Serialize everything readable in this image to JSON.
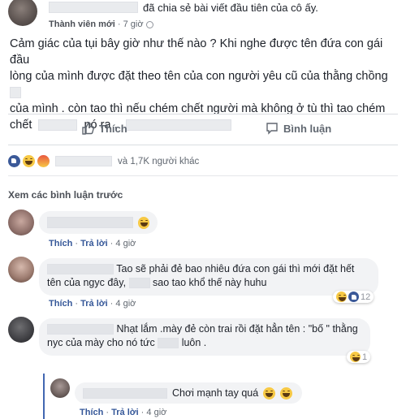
{
  "post": {
    "header_text": "đã chia sẻ bài viết đầu tiên của cô ấy.",
    "member_label": "Thành viên mới",
    "separator": "·",
    "time": "7 giờ",
    "body_line1": "Cảm giác của tụi bây giờ như thế nào ? Khi nghe được tên đứa con gái đầu",
    "body_line2": "lòng của mình được đặt theo tên của con người yêu cũ của thằng chồng",
    "body_line3": "của mình . còn tao thì nếu chém chết người mà không ở tù thì tao chém",
    "body_line4a": "chết",
    "body_line4b": "nó ra ."
  },
  "actions": {
    "like_label": "Thích",
    "comment_label": "Bình luận"
  },
  "reactions": {
    "summary": "và 1,7K người khác"
  },
  "comments_section": {
    "view_previous": "Xem các bình luận trước"
  },
  "comments": [
    {
      "text": "",
      "like": "Thích",
      "reply": "Trả lời",
      "time": "4 giờ"
    },
    {
      "text_line1": "Tao sẽ phải đẻ bao nhiêu đứa con gái thì mới đặt hết",
      "text_line2a": "tên của ngyc đây,",
      "text_line2b": "sao tao khổ thế này huhu",
      "reaction_count": "12",
      "like": "Thích",
      "reply": "Trả lời",
      "time": "4 giờ"
    },
    {
      "text_line1": "Nhạt lắm .mày đẻ còn trai rồi đặt hẳn tên : \"bố \" thằng",
      "text_line2a": "nyc của mày cho nó tức",
      "text_line2b": "luôn .",
      "reaction_count": "1",
      "like": "Thích",
      "reply": "Trả lời",
      "time": "4 giờ"
    }
  ],
  "reply": {
    "text": "Chơi mạnh tay quá",
    "like": "Thích",
    "reply": "Trả lời",
    "time": "4 giờ"
  },
  "colors": {
    "link_blue": "#365899",
    "meta_gray": "#606770",
    "bubble_bg": "#f2f3f5",
    "divider": "#dadde1"
  }
}
